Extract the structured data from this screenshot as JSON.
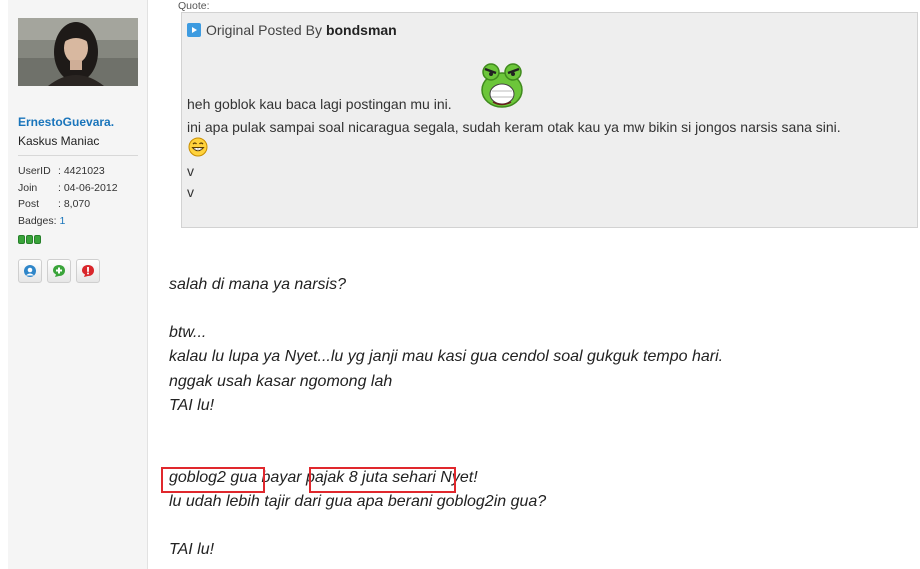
{
  "user": {
    "username": "ErnestoGuevara.",
    "title": "Kaskus Maniac",
    "stats": [
      {
        "label": "UserID",
        "value": ": 4421023"
      },
      {
        "label": "Join",
        "value": ": 04-06-2012"
      },
      {
        "label": "Post",
        "value": ": 8,070"
      }
    ],
    "badges_label": "Badges",
    "badges_sep": ": ",
    "badges_value": "1",
    "reputation_bars": 3,
    "colors": {
      "link": "#1a75bb",
      "reputation": "#3aa43a"
    }
  },
  "quote": {
    "label": "Quote:",
    "original_posted_by": "Original Posted By",
    "author": "bondsman",
    "lines": [
      "heh goblok kau baca lagi postingan mu ini.",
      "ini apa pulak sampai soal nicaragua segala, sudah keram otak kau ya mw bikin si jongos narsis sana sini.",
      "v",
      "v"
    ]
  },
  "post": {
    "lines": [
      "salah di mana ya narsis?",
      "btw...",
      "kalau lu lupa ya Nyet...lu yg janji mau kasi gua cendol soal gukguk tempo hari.",
      "nggak usah kasar ngomong lah",
      "TAI lu!",
      "goblog2 gua bayar pajak 8 juta sehari Nyet!",
      "lu udah lebih tajir dari gua apa berani goblog2in gua?",
      "TAI lu!"
    ],
    "highlight_color": "#e0282d"
  }
}
